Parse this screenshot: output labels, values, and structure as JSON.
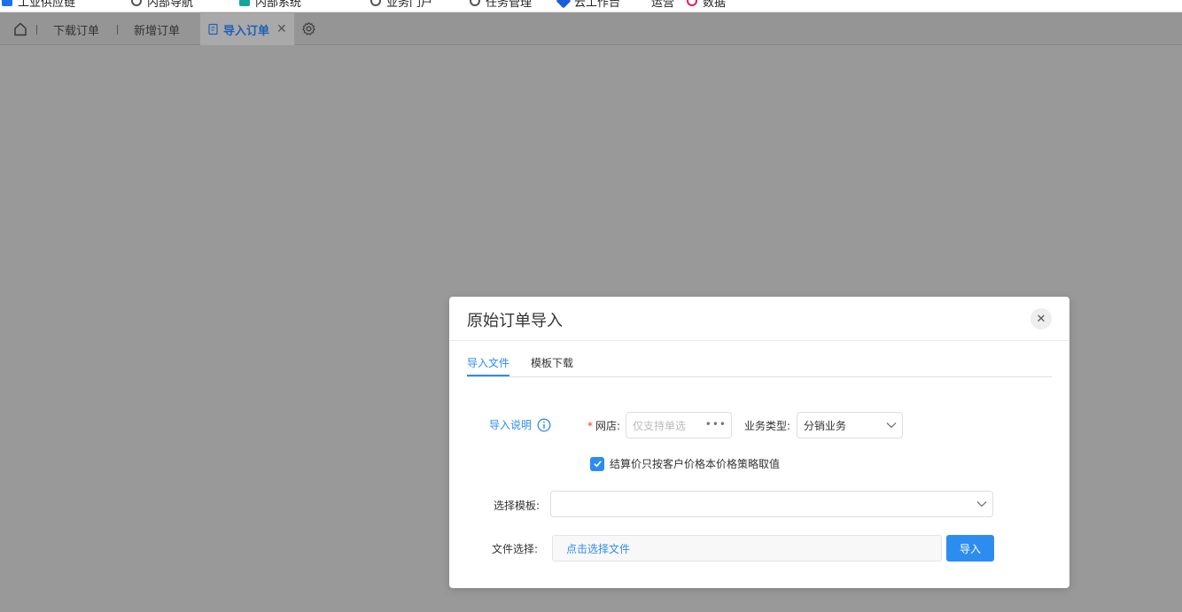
{
  "bookmarks": [
    {
      "label": "工业供应链",
      "color": "#1a73e8"
    },
    {
      "label": "内部导航",
      "color": "#555555"
    },
    {
      "label": "内部系统",
      "color": "#1aa39a"
    },
    {
      "label": "业务门户",
      "color": "#555555"
    },
    {
      "label": "任务管理",
      "color": "#555555"
    },
    {
      "label": "云工作台",
      "color": "#1a5fd8"
    },
    {
      "label": "运营",
      "color": "#555555"
    },
    {
      "label": "数据",
      "color": "#e0205a"
    }
  ],
  "tabbar": {
    "home_icon": "home-icon",
    "tabs": [
      {
        "label": "下载订单"
      },
      {
        "label": "新增订单"
      },
      {
        "label": "导入订单",
        "active": true
      }
    ],
    "close_glyph": "✕",
    "settings_icon": "gear-icon"
  },
  "modal": {
    "title": "原始订单导入",
    "close_glyph": "✕",
    "tabs": [
      {
        "label": "导入文件",
        "active": true
      },
      {
        "label": "模板下载"
      }
    ],
    "instructions_label": "导入说明",
    "shop": {
      "required_mark": "*",
      "label": "网店:",
      "placeholder": "仅支持单选",
      "more_glyph": "•••"
    },
    "business_type": {
      "label": "业务类型:",
      "value": "分销业务"
    },
    "checkbox": {
      "checked": true,
      "label": "结算价只按客户价格本价格策略取值"
    },
    "template": {
      "label": "选择模板:",
      "value": ""
    },
    "file": {
      "label": "文件选择:",
      "button_label": "点击选择文件"
    },
    "import_button": "导入"
  },
  "colors": {
    "primary": "#2d8cf0",
    "overlay": "#999999",
    "required": "#ed4014"
  }
}
